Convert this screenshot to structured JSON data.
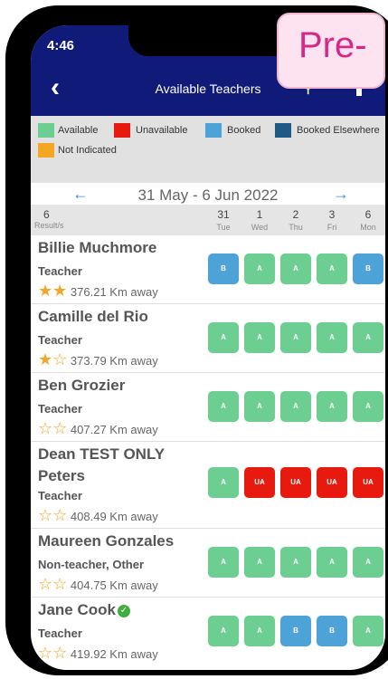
{
  "status_bar": {
    "time": "4:46"
  },
  "header": {
    "title": "Available Teachers"
  },
  "badge": {
    "text": "Pre-"
  },
  "legend": [
    {
      "label": "Available",
      "color": "#6dce91"
    },
    {
      "label": "Unavailable",
      "color": "#e81a0f"
    },
    {
      "label": "Booked",
      "color": "#4da3d8"
    },
    {
      "label": "Booked Elsewhere",
      "color": "#1d5a84"
    },
    {
      "label": "Not Indicated",
      "color": "#f5a623"
    }
  ],
  "week": {
    "label": "31 May - 6 Jun 2022"
  },
  "results": {
    "count": "6",
    "label": "Result/s"
  },
  "days": [
    {
      "num": "31",
      "name": "Tue"
    },
    {
      "num": "1",
      "name": "Wed"
    },
    {
      "num": "2",
      "name": "Thu"
    },
    {
      "num": "3",
      "name": "Fri"
    },
    {
      "num": "6",
      "name": "Mon"
    }
  ],
  "teachers": [
    {
      "name": "Billie Muchmore",
      "role": "Teacher",
      "distance": "376.21 Km away",
      "stars": 2,
      "status": [
        "B",
        "A",
        "A",
        "A",
        "B"
      ]
    },
    {
      "name": "Camille del Rio",
      "role": "Teacher",
      "distance": "373.79 Km away",
      "stars": 1,
      "status": [
        "A",
        "A",
        "A",
        "A",
        "A"
      ]
    },
    {
      "name": "Ben Grozier",
      "role": "Teacher",
      "distance": "407.27 Km away",
      "stars": 0,
      "status": [
        "A",
        "A",
        "A",
        "A",
        "A"
      ]
    },
    {
      "name_line1": "Dean TEST ONLY",
      "name_line2": "Peters",
      "role": "Teacher",
      "distance": "408.49 Km away",
      "stars": 0,
      "status": [
        "A",
        "UA",
        "UA",
        "UA",
        "UA"
      ]
    },
    {
      "name": "Maureen Gonzales",
      "role": "Non-teacher, Other",
      "distance": "404.75 Km away",
      "stars": 0,
      "status": [
        "A",
        "A",
        "A",
        "A",
        "A"
      ]
    },
    {
      "name": "Jane Cook",
      "role": "Teacher",
      "distance": "419.92 Km away",
      "stars": 0,
      "verified": true,
      "status": [
        "A",
        "A",
        "B",
        "B",
        "A"
      ]
    }
  ]
}
